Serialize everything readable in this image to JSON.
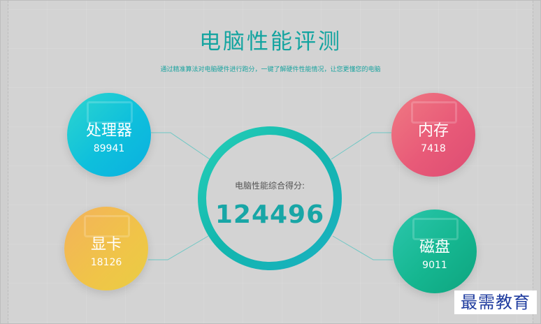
{
  "header": {
    "title": "电脑性能评测",
    "subtitle": "通过精准算法对电脑硬件进行跑分，一键了解硬件性能情况，让您更懂您的电脑"
  },
  "center": {
    "caption": "电脑性能综合得分:",
    "score": "124496"
  },
  "components": {
    "cpu": {
      "label": "处理器",
      "value": "89941"
    },
    "memory": {
      "label": "内存",
      "value": "7418"
    },
    "gpu": {
      "label": "显卡",
      "value": "18126"
    },
    "disk": {
      "label": "磁盘",
      "value": "9011"
    }
  },
  "watermark": {
    "text": "最需教育"
  },
  "colors": {
    "accent": "#14a4a0",
    "cpu": "#0ebfdc",
    "memory": "#e85a78",
    "gpu": "#f0c448",
    "disk": "#15b690"
  }
}
